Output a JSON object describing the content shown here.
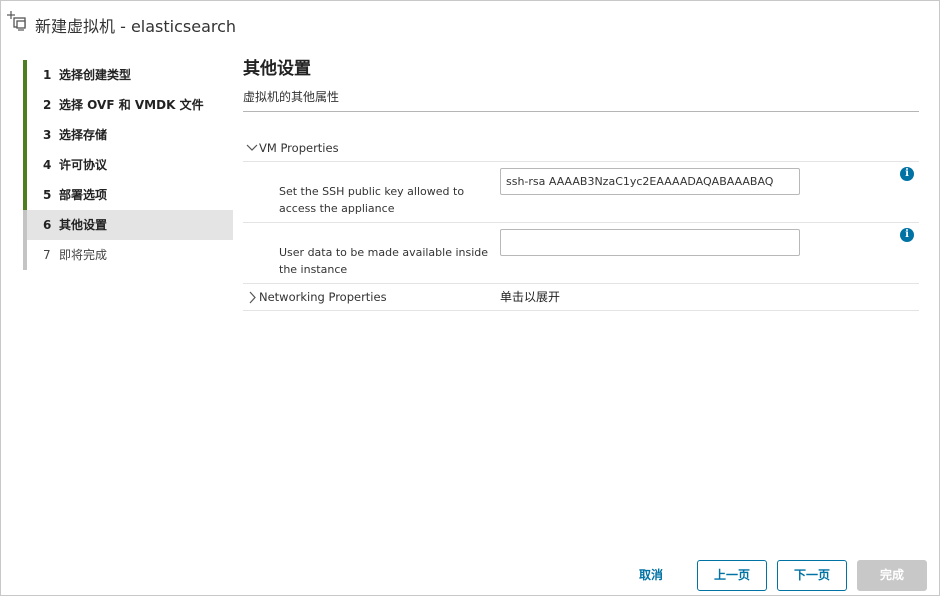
{
  "dialog": {
    "title": "新建虚拟机 - elasticsearch",
    "icon": "new-vm-icon"
  },
  "steps": [
    {
      "num": "1",
      "label": "选择创建类型",
      "state": "done"
    },
    {
      "num": "2",
      "label": "选择 OVF 和 VMDK 文件",
      "state": "done"
    },
    {
      "num": "3",
      "label": "选择存储",
      "state": "done"
    },
    {
      "num": "4",
      "label": "许可协议",
      "state": "done"
    },
    {
      "num": "5",
      "label": "部署选项",
      "state": "done"
    },
    {
      "num": "6",
      "label": "其他设置",
      "state": "current"
    },
    {
      "num": "7",
      "label": "即将完成",
      "state": "pending"
    }
  ],
  "main": {
    "title": "其他设置",
    "subtitle": "虚拟机的其他属性",
    "vm_properties": {
      "label": "VM Properties",
      "expanded": true,
      "properties": [
        {
          "label": "Set the SSH public key allowed to access the appliance",
          "value": "ssh-rsa AAAAB3NzaC1yc2EAAAADAQABAAABAQ",
          "placeholder": "",
          "info_icon": "info-icon"
        },
        {
          "label": "User data to be made available inside the instance",
          "value": "",
          "placeholder": "",
          "info_icon": "info-icon"
        }
      ]
    },
    "networking_properties": {
      "label": "Networking Properties",
      "expanded": false,
      "hint": "单击以展开"
    }
  },
  "footer": {
    "cancel_label": "取消",
    "back_label": "上一页",
    "next_label": "下一页",
    "finish_label": "完成",
    "finish_disabled": true
  },
  "colors": {
    "step_done_bar": "#4f7e1f",
    "step_pending_bar": "#c4c4c4",
    "accent": "#0072a3",
    "disabled": "#c8c8c8"
  }
}
